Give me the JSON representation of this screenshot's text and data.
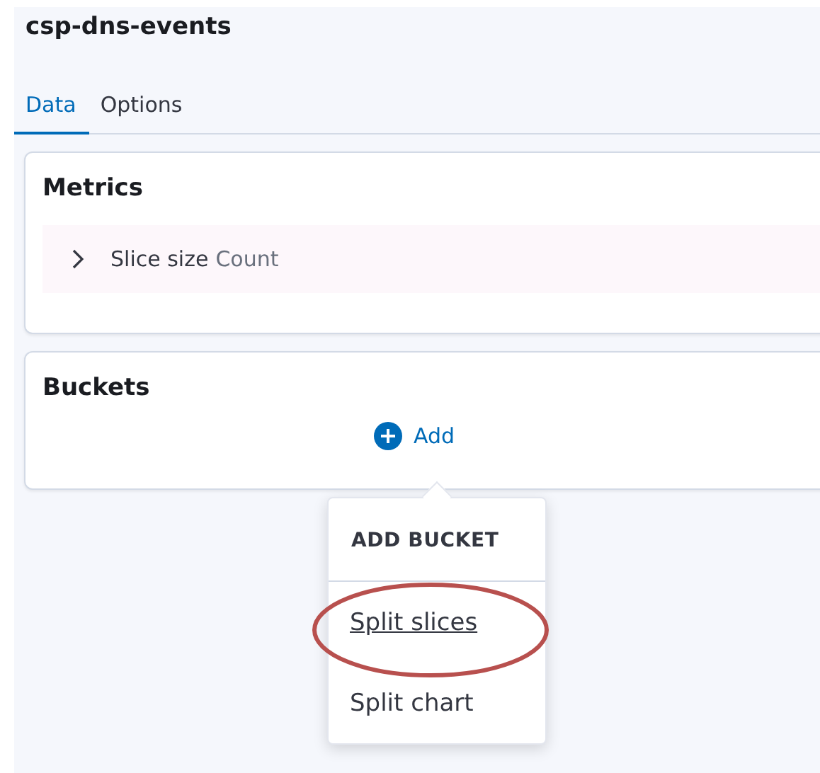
{
  "title": "csp-dns-events",
  "tabs": [
    {
      "label": "Data",
      "selected": true
    },
    {
      "label": "Options",
      "selected": false
    }
  ],
  "metrics": {
    "title": "Metrics",
    "items": [
      {
        "label": "Slice size",
        "value": "Count",
        "expanded": false
      }
    ]
  },
  "buckets": {
    "title": "Buckets",
    "add_label": "Add"
  },
  "popover": {
    "title": "ADD BUCKET",
    "items": [
      {
        "label": "Split slices",
        "hovered": true,
        "circled": true
      },
      {
        "label": "Split chart",
        "hovered": false,
        "circled": false
      }
    ]
  }
}
